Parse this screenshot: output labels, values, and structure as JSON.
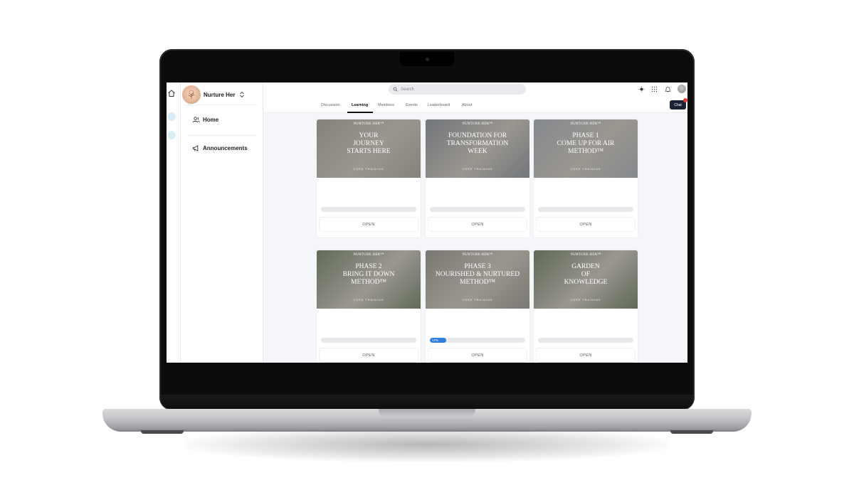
{
  "app": {
    "community_name": "Nurture Her",
    "search_placeholder": "Search"
  },
  "sidebar": {
    "items": [
      {
        "label": "Home",
        "icon": "users-icon"
      },
      {
        "label": "Announcements",
        "icon": "megaphone-icon"
      }
    ]
  },
  "tabs": [
    {
      "label": "Discussion",
      "active": false
    },
    {
      "label": "Learning",
      "active": true
    },
    {
      "label": "Members",
      "active": false
    },
    {
      "label": "Events",
      "active": false
    },
    {
      "label": "Leaderboard",
      "active": false
    },
    {
      "label": "About",
      "active": false
    }
  ],
  "chat_label": "Chat",
  "courses": [
    {
      "kicker": "NURTURE HER™",
      "title": "YOUR\nJOURNEY\nSTARTS HERE",
      "subtitle": "CORE TRAINING",
      "progress": 0,
      "progress_label": "",
      "button": "OPEN",
      "tint": "#b9b1a6"
    },
    {
      "kicker": "NURTURE HER™",
      "title": "FOUNDATION FOR\nTRANSFORMATION\nWEEK",
      "subtitle": "CORE TRAINING",
      "progress": 0,
      "progress_label": "",
      "button": "OPEN",
      "tint": "#9aa0a8"
    },
    {
      "kicker": "NURTURE HER™",
      "title": "PHASE 1\nCOME UP FOR AIR\nMETHOD™",
      "subtitle": "CORE TRAINING",
      "progress": 0,
      "progress_label": "",
      "button": "OPEN",
      "tint": "#b7bcc4"
    },
    {
      "kicker": "NURTURE HER™",
      "title": "PHASE 2\nBRING IT DOWN\nMETHOD™",
      "subtitle": "CORE TRAINING",
      "progress": 0,
      "progress_label": "",
      "button": "OPEN",
      "tint": "#7f8f73"
    },
    {
      "kicker": "NURTURE HER™",
      "title": "PHASE 3\nNOURISHED & NURTURED\nMETHOD™",
      "subtitle": "CORE TRAINING",
      "progress": 0.17,
      "progress_label": "17%",
      "button": "OPEN",
      "tint": "#a7a39b"
    },
    {
      "kicker": "NURTURE HER™",
      "title": "GARDEN\nOF\nKNOWLEDGE",
      "subtitle": "CORE TRAINING",
      "progress": 0,
      "progress_label": "",
      "button": "OPEN",
      "tint": "#7b8c6f"
    }
  ]
}
